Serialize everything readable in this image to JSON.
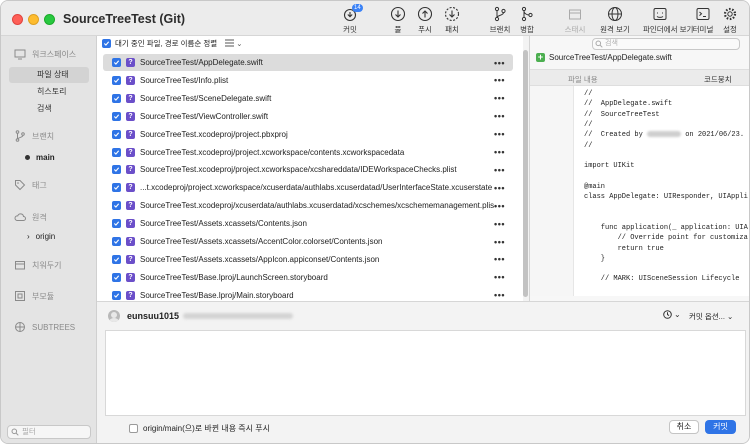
{
  "window": {
    "title": "SourceTreeTest (Git)"
  },
  "toolbar": {
    "commit": {
      "label": "커밋",
      "badge": "14"
    },
    "pull": {
      "label": "풀"
    },
    "push": {
      "label": "푸시"
    },
    "fetch": {
      "label": "패치"
    },
    "branch": {
      "label": "브랜치"
    },
    "merge": {
      "label": "병합"
    },
    "stash": {
      "label": "스태시"
    },
    "remote_view": {
      "label": "원격 보기"
    },
    "finder_view": {
      "label": "파인더에서 보기"
    },
    "terminal": {
      "label": "터미널"
    },
    "settings": {
      "label": "설정"
    }
  },
  "sidebar": {
    "workspace": "워크스페이스",
    "file_status": "파일 상태",
    "history": "히스토리",
    "search": "검색",
    "branches": "브랜치",
    "branch_main": "main",
    "tags": "태그",
    "remotes": "원격",
    "remote_origin": "origin",
    "stashes": "치워두기",
    "submodules": "부모듈",
    "subtrees": "SUBTREES",
    "filter_placeholder": "필터"
  },
  "file_list": {
    "header_label": "대기 중인 파일, 경로 이름순 정렬",
    "row_menu": "•••",
    "files": [
      "SourceTreeTest/AppDelegate.swift",
      "SourceTreeTest/Info.plist",
      "SourceTreeTest/SceneDelegate.swift",
      "SourceTreeTest/ViewController.swift",
      "SourceTreeTest.xcodeproj/project.pbxproj",
      "SourceTreeTest.xcodeproj/project.xcworkspace/contents.xcworkspacedata",
      "SourceTreeTest.xcodeproj/project.xcworkspace/xcshareddata/IDEWorkspaceChecks.plist",
      "...t.xcodeproj/project.xcworkspace/xcuserdata/authlabs.xcuserdatad/UserInterfaceState.xcuserstate",
      "SourceTreeTest.xcodeproj/xcuserdata/authlabs.xcuserdatad/xcschemes/xcschememanagement.plist",
      "SourceTreeTest/Assets.xcassets/Contents.json",
      "SourceTreeTest/Assets.xcassets/AccentColor.colorset/Contents.json",
      "SourceTreeTest/Assets.xcassets/AppIcon.appiconset/Contents.json",
      "SourceTreeTest/Base.lproj/LaunchScreen.storyboard",
      "SourceTreeTest/Base.lproj/Main.storyboard"
    ]
  },
  "diff": {
    "search_placeholder": "검색",
    "file_name": "SourceTreeTest/AppDelegate.swift",
    "hunk_label": "파일 내용",
    "hunk_action": "코드뭉치",
    "code_lines": [
      "//",
      "//  AppDelegate.swift",
      "//  SourceTreeTest",
      "//",
      "//  Created by ",
      "//",
      "",
      "import UIKit",
      "",
      "@main",
      "class AppDelegate: UIResponder, UIAppli",
      "",
      "",
      "    func application(_ application: UIA",
      "        // Override point for customiza",
      "        return true",
      "    }",
      "",
      "    // MARK: UISceneSession Lifecycle"
    ],
    "created_suffix": " on 2021/06/23."
  },
  "commit": {
    "author": "eunsuu1015",
    "options_label": "커밋 옵션...",
    "push_immediately": "origin/main(으)로 바뀐 내용 즉시 푸시",
    "cancel": "취소",
    "commit": "커밋"
  },
  "colors": {
    "accent": "#2f74e6",
    "untracked": "#6b4fc9"
  }
}
